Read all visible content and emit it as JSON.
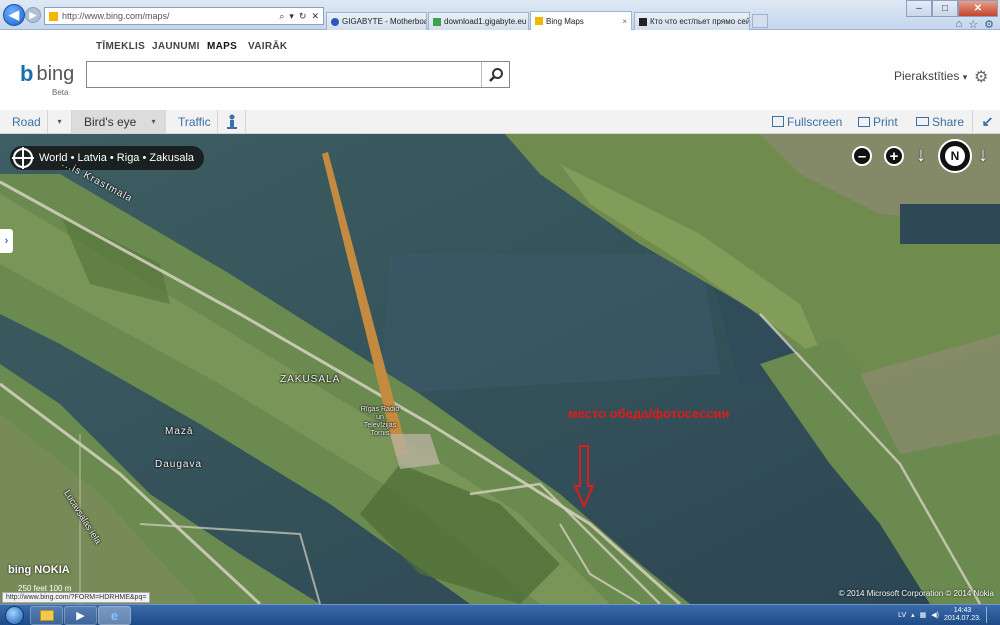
{
  "browser": {
    "back_icon": "back-arrow-icon",
    "address": "http://www.bing.com/maps/",
    "tabs": [
      {
        "label": "GIGABYTE - Motherboard - So...",
        "icon": "gigabyte-icon"
      },
      {
        "label": "download1.gigabyte.eu",
        "icon": "download-icon"
      },
      {
        "label": "Bing Maps",
        "icon": "bing-icon",
        "active": true
      },
      {
        "label": "Кто что ест/пьет прямо сейч...",
        "icon": "site-icon"
      }
    ],
    "window_controls": [
      "–",
      "□",
      "✕"
    ],
    "tool_icons": [
      "⌂",
      "☆",
      "⚙"
    ]
  },
  "bing": {
    "nav": [
      "TĪMEKLIS",
      "JAUNUMI",
      "MAPS",
      "VAIRĀK"
    ],
    "active_nav": "MAPS",
    "logo_text": "bing",
    "beta": "Beta",
    "search_value": "",
    "signin": "Pierakstīties",
    "signin_caret": "▾"
  },
  "toolbar": {
    "road": "Road",
    "birds_eye": "Bird's eye",
    "traffic": "Traffic",
    "fullscreen": "Fullscreen",
    "print": "Print",
    "share": "Share",
    "caret": "▾"
  },
  "map": {
    "breadcrumb": "World • Latvia • Riga • Zakusala",
    "labels": {
      "krastmala": "...is Krastmala",
      "zakusala": "ZAKUSALA",
      "tower": "Rīgas Radio un Televīzijas Tornis",
      "maza": "Mazā",
      "daugava": "Daugava",
      "street": "Lucavsalas iela"
    },
    "annotation": "место обеда/фотосессии",
    "zoom_out": "–",
    "zoom_in": "+",
    "compass": "N",
    "scale_text": "250 feet       100 m",
    "watermark": "bing  NOKIA",
    "copyright": "© 2014 Microsoft Corporation   © 2014 Nokia",
    "status_url": "http://www.bing.com/?FORM=HDRHME&pq="
  },
  "taskbar": {
    "lang": "LV",
    "time": "14:43",
    "date": "2014.07.23."
  },
  "colors": {
    "water": "#314d57",
    "land": "#6e8f52",
    "accent": "#3a6fa8",
    "annotation": "#e01b1b"
  }
}
